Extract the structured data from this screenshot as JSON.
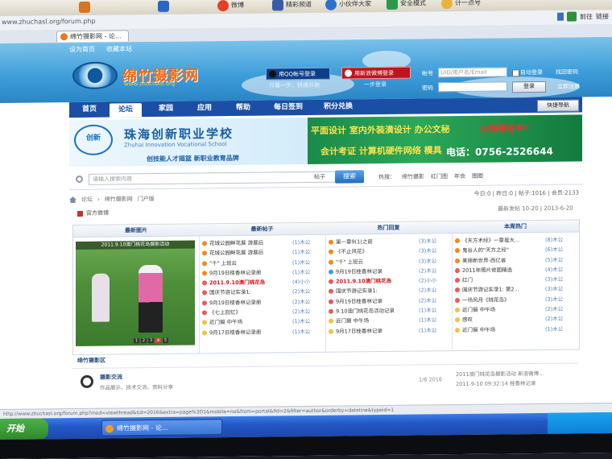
{
  "window": {
    "title": "绵竹摄影网 - 论...",
    "url": "www.zhuchasl.org/forum.php"
  },
  "topbar": {
    "items": [
      "",
      "",
      "",
      "微博",
      "精彩频道",
      "小伙伴大家",
      "安全模式",
      "计一点号"
    ]
  },
  "browser_buttons": {
    "go": "前往",
    "links": "链接"
  },
  "site": {
    "name": "绵竹摄影网",
    "domain": "www.zhuchasl.org",
    "toplinks": [
      "设为首页",
      "收藏本站"
    ],
    "qq_login": "用QQ帐号登录",
    "weibo_login": "用新浪微博登录",
    "qq_hint": "只需一步，快速开始",
    "weibo_hint": "一步登录",
    "login": {
      "user_label": "帐号",
      "user_placeholder": "UID/用户名/Email",
      "auto_login": "自动登录",
      "forgot": "找回密码",
      "pass_label": "密码",
      "login_btn": "登录",
      "register": "立即注册"
    }
  },
  "nav": {
    "items": [
      "首页",
      "论坛",
      "家园",
      "应用",
      "帮助",
      "每日签到",
      "积分兑换"
    ],
    "quick": "快捷导航"
  },
  "banner_left": {
    "logo": "创新",
    "title": "珠海创新职业学校",
    "english": "Zhuhai Innovation Vocational School",
    "slogan": "创技能人才摇篮  新职业教育品牌"
  },
  "banner_right": {
    "line1": "平面设计 室内外装潢设计 办公文秘",
    "line2": "会计考证 计算机硬件网络 模具",
    "hot": "火热报名中！",
    "tel": "电话：0756-2526644"
  },
  "search": {
    "placeholder": "请输入搜索内容",
    "type": "帖子",
    "button": "搜索",
    "hot_label": "热搜：",
    "hot_words": [
      "绵竹摄影",
      "红门图",
      "年会",
      "圈圈"
    ]
  },
  "breadcrumb": {
    "items": [
      "论坛",
      "绵竹摄影网",
      "门户版"
    ],
    "right": "今日:0 | 昨日:0 | 帖子:1016 | 会员:2133"
  },
  "announcement": {
    "label": "官方微博"
  },
  "time_text": "最新发帖 10-20 | 2013-6-20",
  "columns": {
    "c1": "最新图片",
    "c2": "最新帖子",
    "c3": "热门回复",
    "c4": "本周热门"
  },
  "photo": {
    "caption": "2011.9.10澳门桃花岛摄影活动",
    "dots": [
      "1",
      "2",
      "3",
      "4",
      "5"
    ]
  },
  "list2": [
    {
      "t": "花城公园鲜花展  游展后",
      "a": "(1)木公",
      "c": "#f08a1a",
      "red": false
    },
    {
      "t": "花城公园鲜花展  游展后",
      "a": "(1)木公",
      "c": "#f08a1a",
      "red": false
    },
    {
      "t": "\"千\"  上班云",
      "a": "(1)木公",
      "c": "#f08a1a",
      "red": false
    },
    {
      "t": "9月19日桂香林记录册",
      "a": "(1)木公",
      "c": "#f08a1a",
      "red": false
    },
    {
      "t": "2011.9.10澳门桃花岛",
      "a": "(4)小小",
      "c": "#e95a5a",
      "red": true
    },
    {
      "t": "国庆节游记实录1:",
      "a": "(2)木公",
      "c": "#e95a5a",
      "red": false
    },
    {
      "t": "9月19日桂香林记录册",
      "a": "(2)木公",
      "c": "#e95a5a",
      "red": false
    },
    {
      "t": "《七上回忆》",
      "a": "(2)木公",
      "c": "#e95a5a",
      "red": false
    },
    {
      "t": "近门摄  中午场",
      "a": "(1)木公",
      "c": "#f2c04a",
      "red": false
    },
    {
      "t": "9月17日桂香林记录册",
      "a": "(1)木公",
      "c": "#f2c04a",
      "red": false
    }
  ],
  "list3": [
    {
      "t": "第一章9(1)之前",
      "a": "(3)木公",
      "c": "#f08a1a",
      "red": false
    },
    {
      "t": "《不止风花》",
      "a": "(3)木公",
      "c": "#f08a1a",
      "red": false
    },
    {
      "t": "\"千\"  上班云",
      "a": "(3)木公",
      "c": "#f08a1a",
      "red": false
    },
    {
      "t": "9月19日桂香林记录",
      "a": "(2)木公",
      "c": "#3ba0e0",
      "red": false
    },
    {
      "t": "2011.9.10澳门桃花岛",
      "a": "(2)小小",
      "c": "#e95a5a",
      "red": true
    },
    {
      "t": "国庆节游记实录1:",
      "a": "(2)木公",
      "c": "#e95a5a",
      "red": false
    },
    {
      "t": "9月19日桂香林记录",
      "a": "(2)木公",
      "c": "#e95a5a",
      "red": false
    },
    {
      "t": "9.10澳门桃花岛活动记录",
      "a": "(1)木公",
      "c": "#e95a5a",
      "red": false
    },
    {
      "t": "近门摄  中午场",
      "a": "(1)木公",
      "c": "#f2c04a",
      "red": false
    },
    {
      "t": "9月17日桂香林记录",
      "a": "(1)木公",
      "c": "#f2c04a",
      "red": false
    }
  ],
  "list4": [
    {
      "t": "《天方术经》一章是大...",
      "a": "(8)木公",
      "c": "#f08a1a",
      "red": false
    },
    {
      "t": "鬼谷人的\"天方之经\"",
      "a": "(6)木公",
      "c": "#f08a1a",
      "red": false
    },
    {
      "t": "美丽新世界-西亿省",
      "a": "(5)木公",
      "c": "#f08a1a",
      "red": false
    },
    {
      "t": "2011年照片修图精选",
      "a": "(4)木公",
      "c": "#e95a5a",
      "red": false
    },
    {
      "t": "红门",
      "a": "(3)木公",
      "c": "#e95a5a",
      "red": false
    },
    {
      "t": "国庆节游记实录1:  第2...",
      "a": "(3)木公",
      "c": "#e95a5a",
      "red": false
    },
    {
      "t": "一场风月《桃花岛》",
      "a": "(3)木公",
      "c": "#e95a5a",
      "red": false
    },
    {
      "t": "近门摄  中午场",
      "a": "(2)木公",
      "c": "#f2c04a",
      "red": false
    },
    {
      "t": "感叹",
      "a": "(2)木公",
      "c": "#f2c04a",
      "red": false
    },
    {
      "t": "近门摄  中午场",
      "a": "(1)木公",
      "c": "#f2c04a",
      "red": false
    }
  ],
  "section": {
    "title": "绵竹摄影区"
  },
  "forum": {
    "name": "摄影交流",
    "desc": "作品展示、技术交流、资料分享",
    "count": "1/6  2016",
    "last1": "2011澳门桃花岛摄影活动 新浪微博...",
    "last2": "2011-9-10 09:32:14  桂香林记录"
  },
  "statusbar": "http://www.zhuchasl.org/forum.php?mod=viewthread&tid=2016&extra=page%3D1&mobile=no&from=portal&fid=2&filter=author&orderby=dateline&typeid=1",
  "taskbar": {
    "start": "开始",
    "task": "绵竹摄影网 - 论..."
  }
}
